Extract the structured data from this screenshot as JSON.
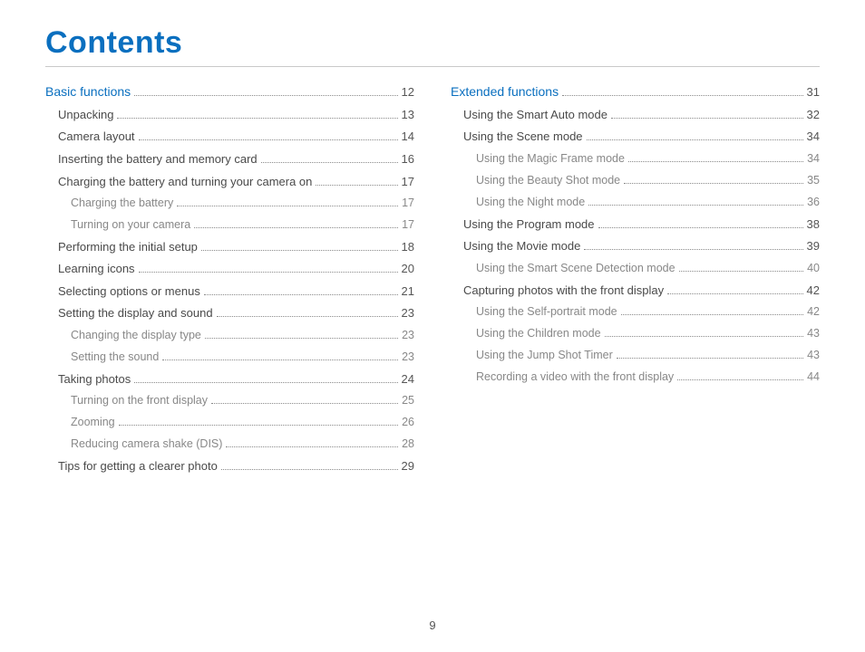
{
  "title": "Contents",
  "page_number": "9",
  "columns": [
    [
      {
        "level": 0,
        "text": "Basic functions",
        "page": "12"
      },
      {
        "level": 1,
        "text": "Unpacking",
        "page": "13"
      },
      {
        "level": 1,
        "text": "Camera layout",
        "page": "14"
      },
      {
        "level": 1,
        "text": "Inserting the battery and memory card",
        "page": "16"
      },
      {
        "level": 1,
        "text": "Charging the battery and turning your camera on",
        "page": "17"
      },
      {
        "level": 2,
        "text": "Charging the battery",
        "page": "17"
      },
      {
        "level": 2,
        "text": "Turning on your camera",
        "page": "17"
      },
      {
        "level": 1,
        "text": "Performing the initial setup",
        "page": "18"
      },
      {
        "level": 1,
        "text": "Learning icons",
        "page": "20"
      },
      {
        "level": 1,
        "text": "Selecting options or menus",
        "page": "21"
      },
      {
        "level": 1,
        "text": "Setting the display and sound",
        "page": "23"
      },
      {
        "level": 2,
        "text": "Changing the display type",
        "page": "23"
      },
      {
        "level": 2,
        "text": "Setting the sound",
        "page": "23"
      },
      {
        "level": 1,
        "text": "Taking photos",
        "page": "24"
      },
      {
        "level": 2,
        "text": "Turning on the front display",
        "page": "25"
      },
      {
        "level": 2,
        "text": "Zooming",
        "page": "26"
      },
      {
        "level": 2,
        "text": "Reducing camera shake (DIS)",
        "page": "28"
      },
      {
        "level": 1,
        "text": "Tips for getting a clearer photo",
        "page": "29"
      }
    ],
    [
      {
        "level": 0,
        "text": "Extended functions",
        "page": "31"
      },
      {
        "level": 1,
        "text": "Using the Smart Auto mode",
        "page": "32"
      },
      {
        "level": 1,
        "text": "Using the Scene mode",
        "page": "34"
      },
      {
        "level": 2,
        "text": "Using the Magic Frame mode",
        "page": "34"
      },
      {
        "level": 2,
        "text": "Using the Beauty Shot mode",
        "page": "35"
      },
      {
        "level": 2,
        "text": "Using the Night mode",
        "page": "36"
      },
      {
        "level": 1,
        "text": "Using the Program mode",
        "page": "38"
      },
      {
        "level": 1,
        "text": "Using the Movie mode",
        "page": "39"
      },
      {
        "level": 2,
        "text": "Using the Smart Scene Detection mode",
        "page": "40"
      },
      {
        "level": 1,
        "text": "Capturing photos with the front display",
        "page": "42"
      },
      {
        "level": 2,
        "text": "Using the Self-portrait mode",
        "page": "42"
      },
      {
        "level": 2,
        "text": "Using the Children mode",
        "page": "43"
      },
      {
        "level": 2,
        "text": "Using the Jump Shot Timer",
        "page": "43"
      },
      {
        "level": 2,
        "text": "Recording a video with the front display",
        "page": "44"
      }
    ]
  ]
}
